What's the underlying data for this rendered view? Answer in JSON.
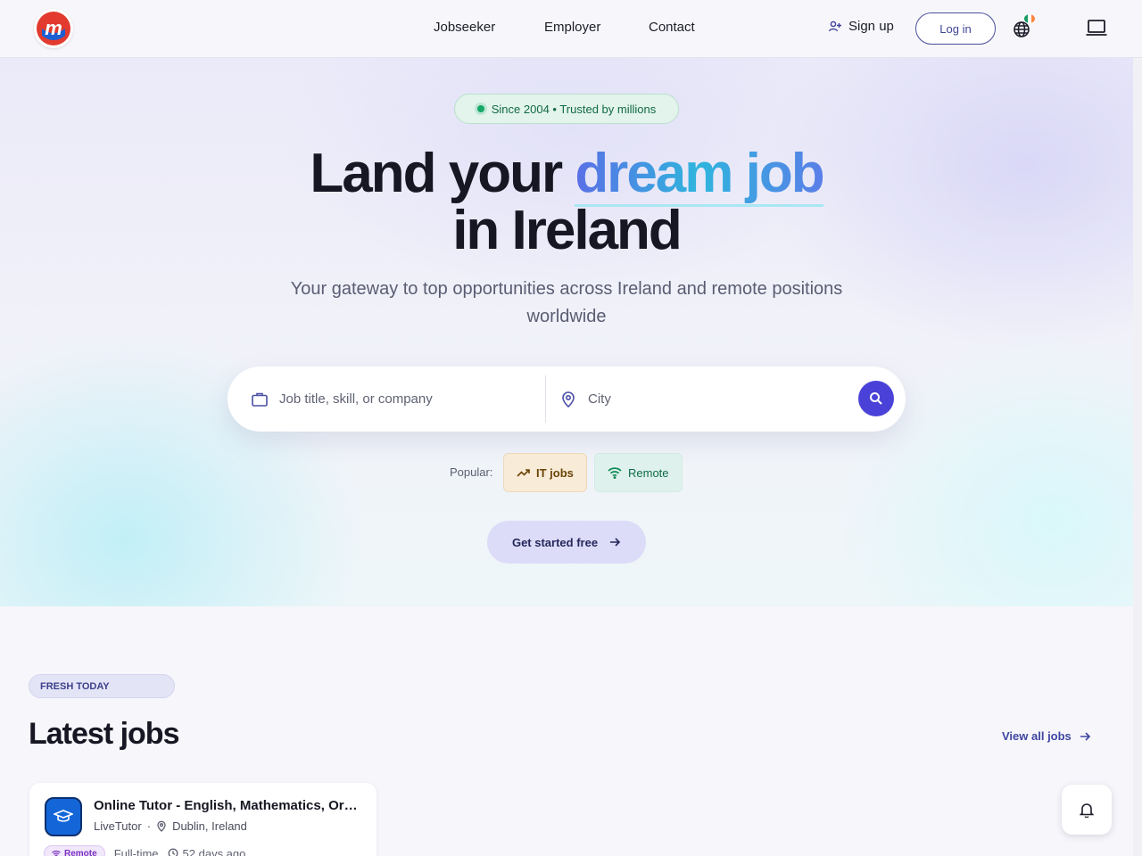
{
  "header": {
    "nav": [
      "Jobseeker",
      "Employer",
      "Contact"
    ],
    "signup_label": "Sign up",
    "login_label": "Log in",
    "icons": [
      "brand-logo",
      "user-plus-icon",
      "globe-icon",
      "ireland-flag-icon",
      "laptop-icon"
    ]
  },
  "hero": {
    "pill_text": "Since 2004 • Trusted by millions",
    "headline_part1": "Land your",
    "headline_accent": "dream job",
    "headline_part2": "in Ireland",
    "subtitle": "Your gateway to top opportunities across Ireland and remote positions worldwide",
    "search": {
      "job_placeholder": "Job title, skill, or company",
      "city_placeholder": "City"
    },
    "popular_label": "Popular:",
    "chips": [
      "IT jobs",
      "Remote"
    ],
    "cta_label": "Get started free"
  },
  "latest": {
    "badge": "FRESH TODAY",
    "title": "Latest jobs",
    "view_all": "View all jobs",
    "jobs": [
      {
        "title": "Online Tutor - English, Mathematics, Or…",
        "company": "LiveTutor",
        "location": "Dublin, Ireland",
        "tag": "Remote",
        "type": "Full-time",
        "posted": "52 days ago"
      }
    ]
  },
  "colors": {
    "accent": "#4a42d8",
    "headline_gradient": [
      "#5a6fe6",
      "#2fb5dd"
    ],
    "pill_green": "#16a868"
  }
}
